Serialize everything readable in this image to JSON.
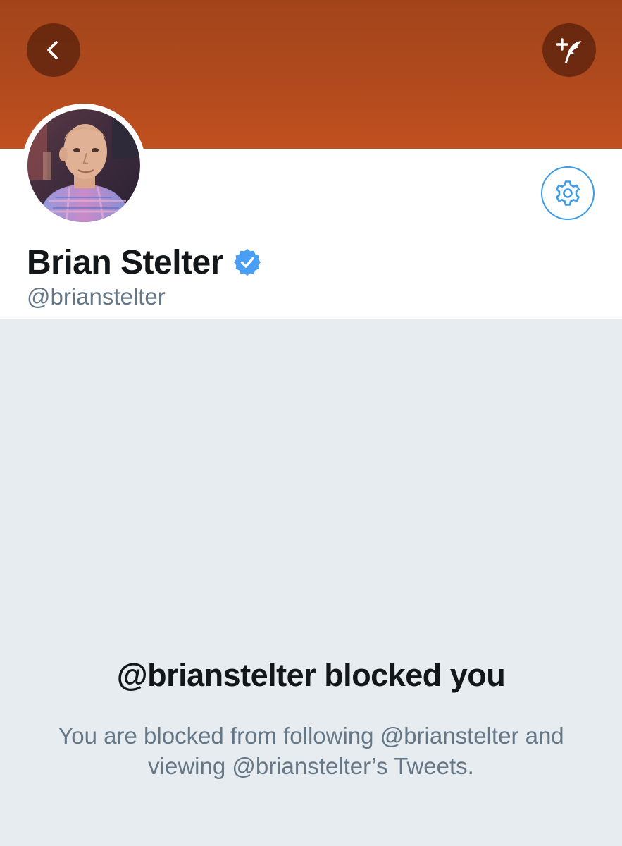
{
  "header": {
    "back_icon": "chevron-left-icon",
    "compose_icon": "compose-tweet-icon",
    "banner_color": "#b04a1e"
  },
  "profile": {
    "display_name": "Brian Stelter",
    "handle": "@brianstelter",
    "verified": true,
    "verified_color": "#4a9ff5",
    "settings_icon": "gear-icon"
  },
  "blocked": {
    "title": "@brianstelter blocked you",
    "description": "You are blocked from following @brianstelter and viewing @brianstelter’s Tweets."
  }
}
